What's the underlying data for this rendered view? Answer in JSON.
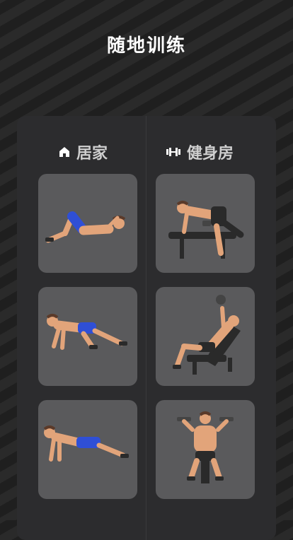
{
  "page": {
    "title": "随地训练"
  },
  "columns": [
    {
      "label": "居家",
      "icon": "home-icon",
      "items": [
        {
          "name": "crunch-exercise-card",
          "illustration": "crunch"
        },
        {
          "name": "mountain-climber-exercise-card",
          "illustration": "mountain-climber"
        },
        {
          "name": "push-up-exercise-card",
          "illustration": "push-up"
        }
      ]
    },
    {
      "label": "健身房",
      "icon": "dumbbell-icon",
      "items": [
        {
          "name": "dumbbell-row-exercise-card",
          "illustration": "bench-row"
        },
        {
          "name": "incline-press-exercise-card",
          "illustration": "incline-press"
        },
        {
          "name": "shoulder-press-exercise-card",
          "illustration": "shoulder-press"
        }
      ]
    }
  ],
  "colors": {
    "background": "#262626",
    "panel": "#2c2c2e",
    "card": "#5a5a5c",
    "skin": "#e2a47a",
    "shorts": "#2f4fd6",
    "dark": "#2a2a2a"
  }
}
